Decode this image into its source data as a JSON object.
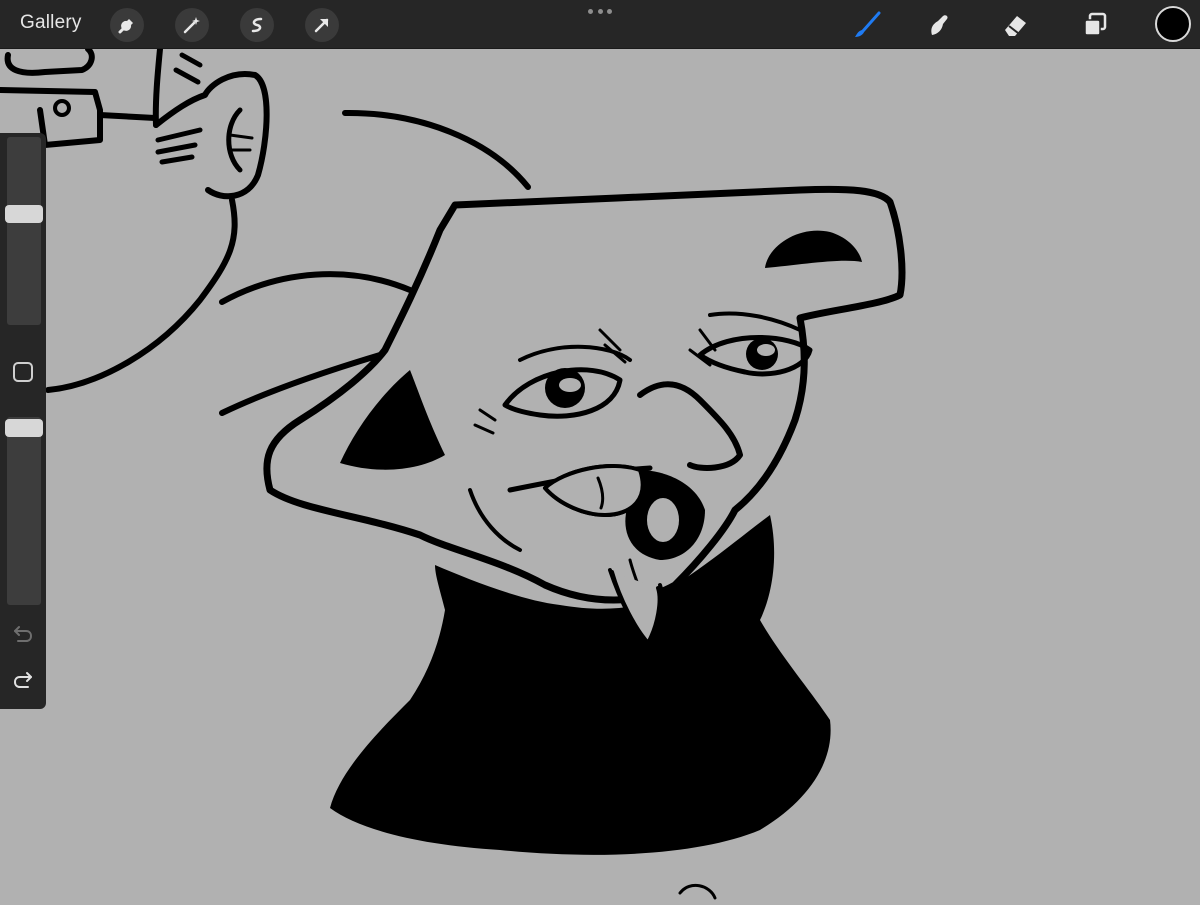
{
  "toolbar": {
    "gallery_label": "Gallery",
    "left_tools": [
      "wrench-icon",
      "magic-wand-icon",
      "selection-s-icon",
      "transform-arrow-icon"
    ],
    "right_tools": [
      "brush-icon",
      "smudge-icon",
      "eraser-icon",
      "layers-icon"
    ],
    "active_tool": "brush-icon",
    "accent_color": "#1f7bf2",
    "current_color": "#000000"
  },
  "sidebar": {
    "brush_size_level": 0.6,
    "opacity_level": 1.0,
    "icons": [
      "modify-square-icon",
      "undo-icon",
      "redo-icon"
    ]
  },
  "colors": {
    "canvas_background": "#b1b1b1",
    "ui_background": "#262626",
    "ink": "#000000"
  }
}
